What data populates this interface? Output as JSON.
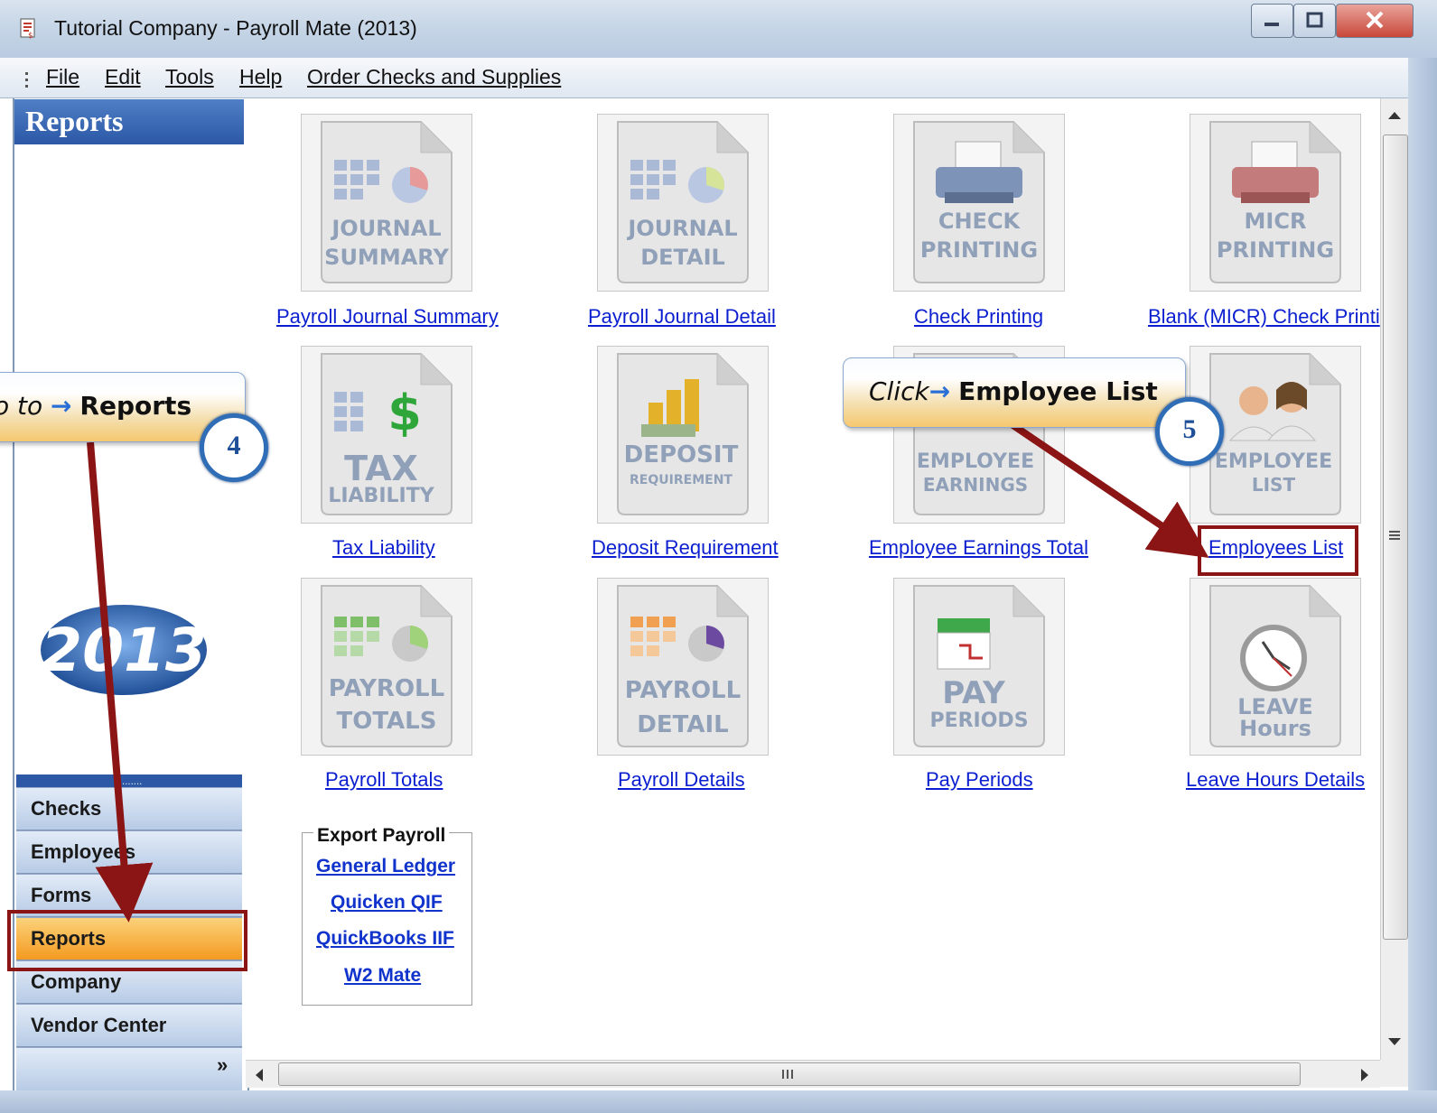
{
  "window": {
    "title": "Tutorial Company - Payroll Mate (2013)"
  },
  "menu": [
    "File",
    "Edit",
    "Tools",
    "Help",
    "Order Checks and Supplies"
  ],
  "sidebar": {
    "header": "Reports",
    "logo_year": "2013",
    "nav": [
      "Checks",
      "Employees",
      "Forms",
      "Reports",
      "Company",
      "Vendor Center"
    ],
    "active": "Reports",
    "more": "»"
  },
  "reports": [
    {
      "icon_line1": "JOURNAL",
      "icon_line2": "SUMMARY",
      "link": "Payroll Journal Summary"
    },
    {
      "icon_line1": "JOURNAL",
      "icon_line2": "DETAIL",
      "link": "Payroll Journal Detail"
    },
    {
      "icon_line1": "CHECK",
      "icon_line2": "PRINTING",
      "link": "Check Printing"
    },
    {
      "icon_line1": "MICR",
      "icon_line2": "PRINTING",
      "link": "Blank (MICR) Check Printi"
    },
    {
      "icon_line1": "TAX",
      "icon_line2": "LIABILITY",
      "link": "Tax Liability"
    },
    {
      "icon_line1": "DEPOSIT",
      "icon_line2": "REQUIREMENT",
      "link": "Deposit Requirement"
    },
    {
      "icon_line1": "EMPLOYEE",
      "icon_line2": "EARNINGS",
      "link": "Employee Earnings Total"
    },
    {
      "icon_line1": "EMPLOYEE",
      "icon_line2": "LIST",
      "link": "Employees List"
    },
    {
      "icon_line1": "PAYROLL",
      "icon_line2": "TOTALS",
      "link": "Payroll Totals"
    },
    {
      "icon_line1": "PAYROLL",
      "icon_line2": "DETAIL",
      "link": "Payroll Details"
    },
    {
      "icon_line1": "PAY",
      "icon_line2": "PERIODS",
      "link": "Pay Periods"
    },
    {
      "icon_line1": "LEAVE",
      "icon_line2": "Hours",
      "link": "Leave Hours Details"
    }
  ],
  "export": {
    "title": "Export Payroll",
    "links": [
      "General Ledger",
      "Quicken QIF",
      "QuickBooks IIF",
      "W2 Mate"
    ]
  },
  "callouts": {
    "step4": {
      "prefix": "o to",
      "arrow": "→",
      "target": "Reports",
      "number": "4"
    },
    "step5": {
      "prefix": "Click",
      "arrow": "→",
      "target": "Employee List",
      "number": "5"
    }
  },
  "colors": {
    "link": "#0b1fd0",
    "active_nav": "#f49a20",
    "annotation": "#8b1414",
    "badge": "#2f6db7"
  }
}
